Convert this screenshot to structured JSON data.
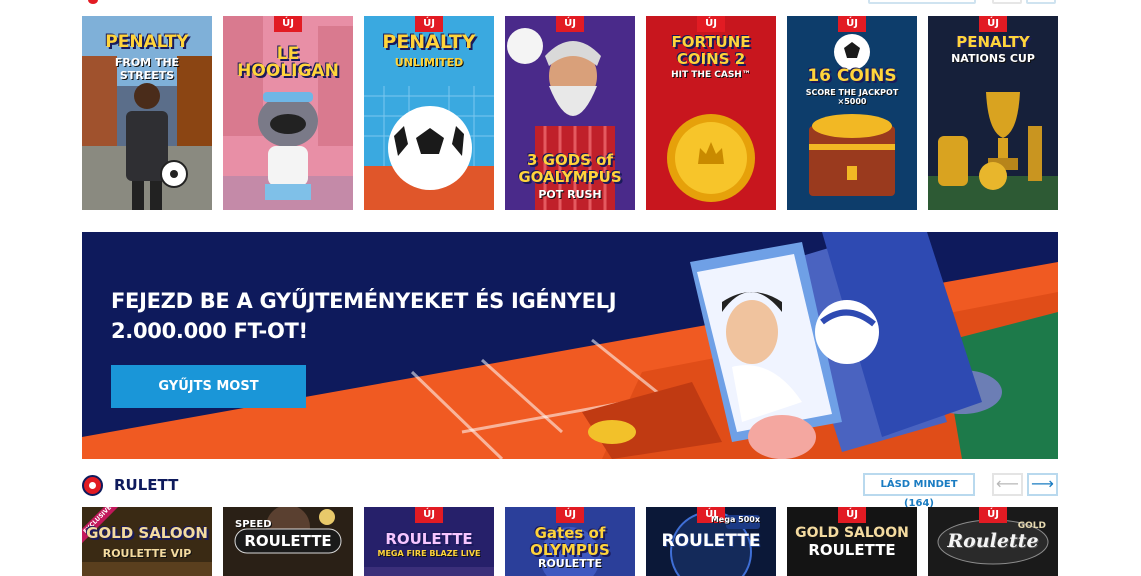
{
  "new_badge": "ÚJ",
  "top_row": [
    {
      "title": "PENALTY",
      "subtitle": "FROM THE STREETS",
      "is_new": false
    },
    {
      "title": "LE HOOLIGAN",
      "subtitle": "",
      "is_new": true
    },
    {
      "title": "PENALTY",
      "subtitle": "UNLIMITED",
      "is_new": true
    },
    {
      "title": "3 GODS of GOALYMPUS",
      "subtitle": "POT RUSH",
      "is_new": true
    },
    {
      "title": "FORTUNE COINS 2",
      "subtitle": "HIT THE CASH™",
      "is_new": true
    },
    {
      "title": "16 COINS",
      "subtitle": "SCORE THE JACKPOT ×5000",
      "is_new": true
    },
    {
      "title": "PENALTY",
      "subtitle": "NATIONS CUP",
      "is_new": true
    }
  ],
  "banner": {
    "title": "FEJEZD BE A GYŰJTEMÉNYEKET ÉS IGÉNYELJ 2.000.000 FT-OT!",
    "cta": "GYŰJTS MOST"
  },
  "section": {
    "title": "RULETT",
    "see_all": "LÁSD MINDET (164)",
    "prev_arrow": "⟵",
    "next_arrow": "⟶"
  },
  "bottom_row": [
    {
      "title": "GOLD SALOON",
      "subtitle": "ROULETTE VIP",
      "is_new": false,
      "exclusive": "EXCLUSIVE"
    },
    {
      "title": "ROULETTE",
      "subtitle": "SPEED",
      "is_new": false
    },
    {
      "title": "ROULETTE",
      "subtitle": "MEGA FIRE BLAZE LIVE",
      "is_new": true
    },
    {
      "title": "Gates of OLYMPUS",
      "subtitle": "ROULETTE",
      "is_new": true
    },
    {
      "title": "ROULETTE",
      "subtitle": "Mega 500x",
      "is_new": true
    },
    {
      "title": "GOLD SALOON",
      "subtitle": "ROULETTE",
      "is_new": true
    },
    {
      "title": "Roulette",
      "subtitle": "GOLD",
      "is_new": true
    }
  ],
  "colors": {
    "brand_navy": "#0e1a5c",
    "cta_blue": "#1a96d8",
    "badge_red": "#e21b23"
  }
}
